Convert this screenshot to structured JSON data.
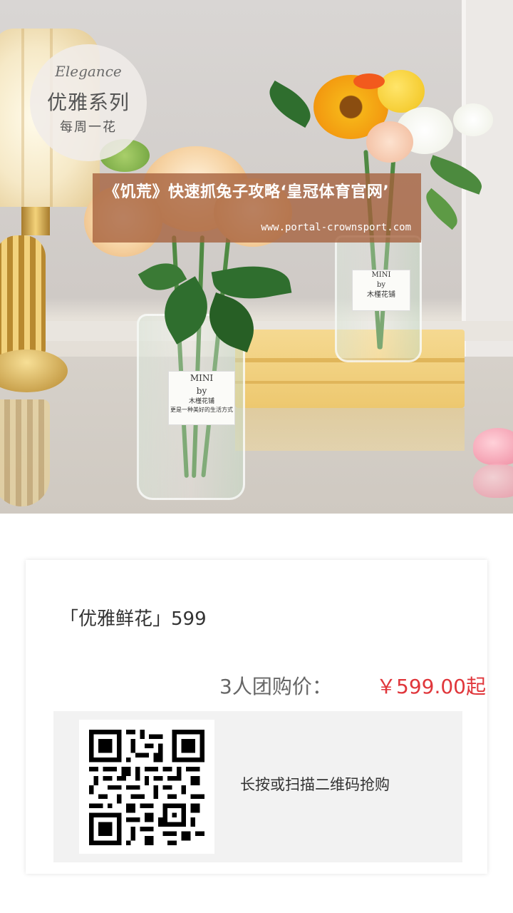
{
  "hero": {
    "brand": {
      "script": "Elegance",
      "title": "优雅系列",
      "subtitle": "每周一花"
    },
    "vase_labels": {
      "main": {
        "line1": "MINI",
        "line2": "by",
        "line3": "木槿花铺",
        "line4": "更是一种美好的生活方式"
      },
      "back": {
        "line1": "MINI",
        "line2": "by",
        "line3": "木槿花铺"
      }
    },
    "banner": {
      "title": "《饥荒》快速抓兔子攻略‘皇冠体育官网’",
      "url": "www.portal-crownsport.com"
    }
  },
  "product": {
    "name": "「优雅鲜花」599",
    "price_label": "3人团购价：",
    "price_value": "￥599.00起",
    "qr_caption": "长按或扫描二维码抢购",
    "qr_icon": "qr-code-icon",
    "colors": {
      "price": "#e0363b",
      "banner_bg": "#a5603c"
    }
  }
}
